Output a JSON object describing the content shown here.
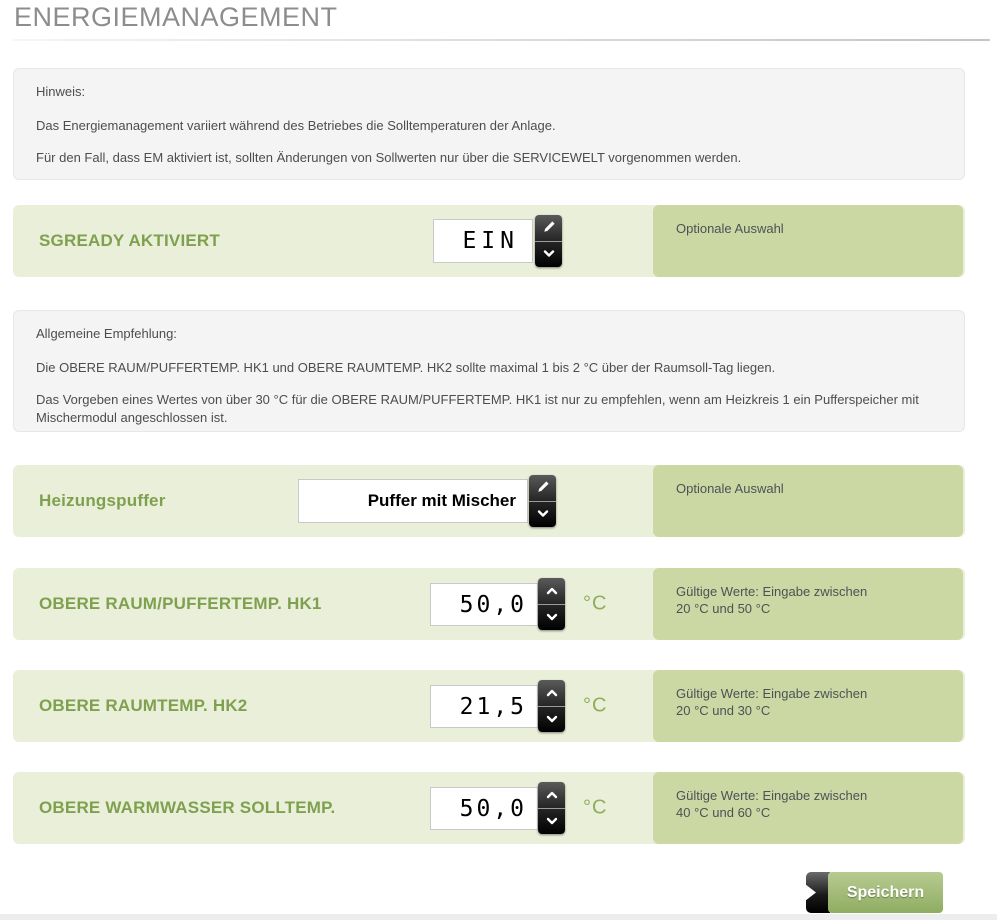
{
  "title": "ENERGIEMANAGEMENT",
  "colors": {
    "accent_green_label": "#7fa14f",
    "row_bg_light_green": "#e9efd9",
    "side_box_green": "#ccd8a3",
    "note_bg_gray": "#f4f4f4",
    "title_gray": "#8d8d8d",
    "button_dark": "#000000",
    "save_button_green": "#8fad61"
  },
  "notes": [
    {
      "heading": "Hinweis:",
      "lines": [
        "Das Energiemanagement variiert während des Betriebes die Solltemperaturen der Anlage.",
        "Für den Fall, dass EM aktiviert ist, sollten Änderungen von Sollwerten nur über die SERVICEWELT vorgenommen werden."
      ]
    },
    {
      "heading": "Allgemeine Empfehlung:",
      "lines": [
        "Die OBERE RAUM/PUFFERTEMP. HK1 und OBERE RAUMTEMP. HK2 sollte maximal 1 bis 2 °C über der Raumsoll-Tag liegen.",
        "Das Vorgeben eines Wertes von über 30 °C für die OBERE RAUM/PUFFERTEMP. HK1 ist nur zu empfehlen, wenn am Heizkreis 1 ein Pufferspeicher mit Mischermodul angeschlossen ist."
      ]
    }
  ],
  "rows": [
    {
      "label": "SGREADY AKTIVIERT",
      "value": "EIN",
      "side": "Optionale Auswahl"
    },
    {
      "label": "Heizungspuffer",
      "value": "Puffer mit Mischer",
      "side": "Optionale Auswahl"
    },
    {
      "label": "OBERE RAUM/PUFFERTEMP. HK1",
      "value": "50,0",
      "unit": "°C",
      "side_lines": [
        "Gültige Werte: Eingabe zwischen",
        "20 °C und 50 °C"
      ]
    },
    {
      "label": "OBERE RAUMTEMP. HK2",
      "value": "21,5",
      "unit": "°C",
      "side_lines": [
        "Gültige Werte: Eingabe zwischen",
        "20 °C und 30 °C"
      ]
    },
    {
      "label": "OBERE WARMWASSER SOLLTEMP.",
      "value": "50,0",
      "unit": "°C",
      "side_lines": [
        "Gültige Werte: Eingabe zwischen",
        "40 °C und 60 °C"
      ]
    }
  ],
  "icons": {
    "edit": "pencil-icon",
    "open": "chevron-down-icon",
    "increment": "chevron-up-icon",
    "decrement": "chevron-down-icon",
    "save_arrow": "chevron-right-icon"
  },
  "save_button": {
    "label": "Speichern"
  }
}
